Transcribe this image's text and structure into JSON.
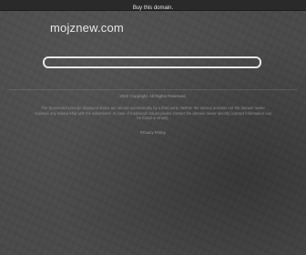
{
  "topbar": {
    "link_text": "Buy this domain."
  },
  "header": {
    "domain": "mojznew.com"
  },
  "search": {
    "placeholder": ""
  },
  "footer": {
    "copyright": "2022 Copyright.  All Rights Reserved.",
    "disclaimer": "The Sponsored Listings displayed above are served automatically by a third party. Neither the service provider nor the domain owner maintain any relationship with the advertisers. In case of trademark issues please contact the domain owner directly (contact information can be found in whois).",
    "privacy_link": "Privacy Policy"
  },
  "colors": {
    "background": "#4a4a4a",
    "topbar": "#2a2a2a",
    "search_border": "#e8e8e8"
  }
}
